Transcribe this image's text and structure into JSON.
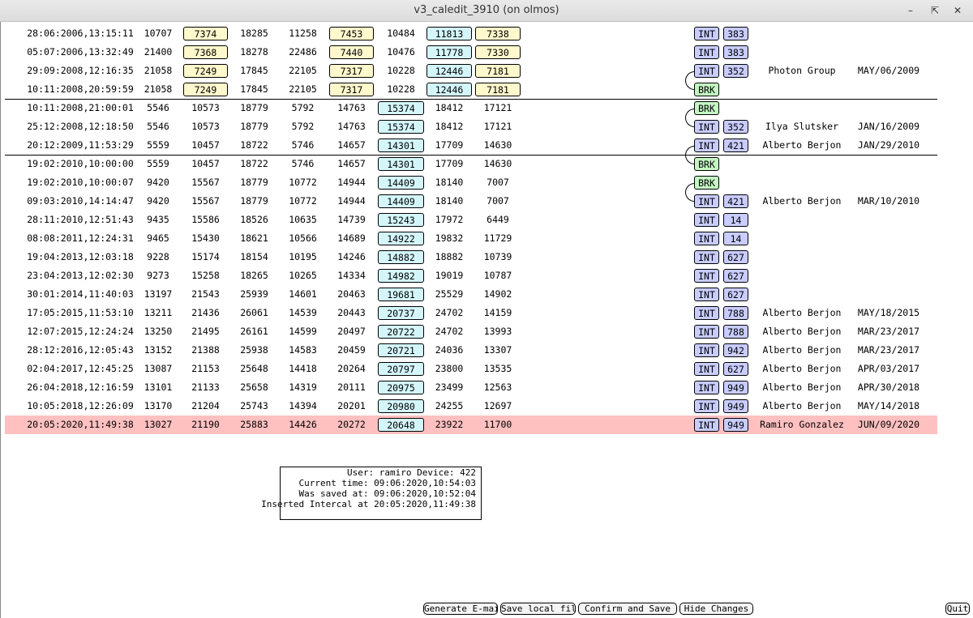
{
  "window": {
    "title": "v3_caledit_3910 (on olmos)"
  },
  "rows": [
    {
      "ts": "28:06:2006,13:15:11",
      "vals": [
        "10707",
        "7374",
        "18285",
        "11258",
        "7453",
        "10484",
        "11813",
        "7338"
      ],
      "type": "INT",
      "num": "383",
      "user": "",
      "date": ""
    },
    {
      "ts": "05:07:2006,13:32:49",
      "vals": [
        "21400",
        "7368",
        "18278",
        "22486",
        "7440",
        "10476",
        "11778",
        "7330"
      ],
      "type": "INT",
      "num": "383",
      "user": "",
      "date": ""
    },
    {
      "ts": "29:09:2008,12:16:35",
      "vals": [
        "21058",
        "7249",
        "17845",
        "22105",
        "7317",
        "10228",
        "12446",
        "7181"
      ],
      "type": "INT",
      "num": "352",
      "user": "Photon Group",
      "date": "MAY/06/2009"
    },
    {
      "ts": "10:11:2008,20:59:59",
      "vals": [
        "21058",
        "7249",
        "17845",
        "22105",
        "7317",
        "10228",
        "12446",
        "7181"
      ],
      "type": "BRK",
      "num": "",
      "user": "",
      "date": ""
    },
    {
      "ts": "10:11:2008,21:00:01",
      "vals": [
        "5546",
        "10573",
        "18779",
        "5792",
        "14763",
        "15374",
        "18412",
        "17121"
      ],
      "type": "BRK",
      "num": "",
      "user": "",
      "date": ""
    },
    {
      "ts": "25:12:2008,12:18:50",
      "vals": [
        "5546",
        "10573",
        "18779",
        "5792",
        "14763",
        "15374",
        "18412",
        "17121"
      ],
      "type": "INT",
      "num": "352",
      "user": "Ilya Slutsker",
      "date": "JAN/16/2009"
    },
    {
      "ts": "20:12:2009,11:53:29",
      "vals": [
        "5559",
        "10457",
        "18722",
        "5746",
        "14657",
        "14301",
        "17709",
        "14630"
      ],
      "type": "INT",
      "num": "421",
      "user": "Alberto Berjon",
      "date": "JAN/29/2010"
    },
    {
      "ts": "19:02:2010,10:00:00",
      "vals": [
        "5559",
        "10457",
        "18722",
        "5746",
        "14657",
        "14301",
        "17709",
        "14630"
      ],
      "type": "BRK",
      "num": "",
      "user": "",
      "date": ""
    },
    {
      "ts": "19:02:2010,10:00:07",
      "vals": [
        "9420",
        "15567",
        "18779",
        "10772",
        "14944",
        "14409",
        "18140",
        "7007"
      ],
      "type": "BRK",
      "num": "",
      "user": "",
      "date": ""
    },
    {
      "ts": "09:03:2010,14:14:47",
      "vals": [
        "9420",
        "15567",
        "18779",
        "10772",
        "14944",
        "14409",
        "18140",
        "7007"
      ],
      "type": "INT",
      "num": "421",
      "user": "Alberto Berjon",
      "date": "MAR/10/2010"
    },
    {
      "ts": "28:11:2010,12:51:43",
      "vals": [
        "9435",
        "15586",
        "18526",
        "10635",
        "14739",
        "15243",
        "17972",
        "6449"
      ],
      "type": "INT",
      "num": "14",
      "user": "",
      "date": ""
    },
    {
      "ts": "08:08:2011,12:24:31",
      "vals": [
        "9465",
        "15430",
        "18621",
        "10566",
        "14689",
        "14922",
        "19832",
        "11729"
      ],
      "type": "INT",
      "num": "14",
      "user": "",
      "date": ""
    },
    {
      "ts": "19:04:2013,12:03:18",
      "vals": [
        "9228",
        "15174",
        "18154",
        "10195",
        "14246",
        "14882",
        "18882",
        "10739"
      ],
      "type": "INT",
      "num": "627",
      "user": "",
      "date": ""
    },
    {
      "ts": "23:04:2013,12:02:30",
      "vals": [
        "9273",
        "15258",
        "18265",
        "10265",
        "14334",
        "14982",
        "19019",
        "10787"
      ],
      "type": "INT",
      "num": "627",
      "user": "",
      "date": ""
    },
    {
      "ts": "30:01:2014,11:40:03",
      "vals": [
        "13197",
        "21543",
        "25939",
        "14601",
        "20463",
        "19681",
        "25529",
        "14902"
      ],
      "type": "INT",
      "num": "627",
      "user": "",
      "date": ""
    },
    {
      "ts": "17:05:2015,11:53:10",
      "vals": [
        "13211",
        "21436",
        "26061",
        "14539",
        "20443",
        "20737",
        "24702",
        "14159"
      ],
      "type": "INT",
      "num": "788",
      "user": "Alberto Berjon",
      "date": "MAY/18/2015"
    },
    {
      "ts": "12:07:2015,12:24:24",
      "vals": [
        "13250",
        "21495",
        "26161",
        "14599",
        "20497",
        "20722",
        "24702",
        "13993"
      ],
      "type": "INT",
      "num": "788",
      "user": "Alberto Berjon",
      "date": "MAR/23/2017"
    },
    {
      "ts": "28:12:2016,12:05:43",
      "vals": [
        "13152",
        "21388",
        "25938",
        "14583",
        "20459",
        "20721",
        "24036",
        "13307"
      ],
      "type": "INT",
      "num": "942",
      "user": "Alberto Berjon",
      "date": "MAR/23/2017"
    },
    {
      "ts": "02:04:2017,12:45:25",
      "vals": [
        "13087",
        "21153",
        "25648",
        "14418",
        "20264",
        "20797",
        "23800",
        "13535"
      ],
      "type": "INT",
      "num": "627",
      "user": "Alberto Berjon",
      "date": "APR/03/2017"
    },
    {
      "ts": "26:04:2018,12:16:59",
      "vals": [
        "13101",
        "21133",
        "25658",
        "14319",
        "20111",
        "20975",
        "23499",
        "12563"
      ],
      "type": "INT",
      "num": "949",
      "user": "Alberto Berjon",
      "date": "APR/30/2018"
    },
    {
      "ts": "10:05:2018,12:26:09",
      "vals": [
        "13170",
        "21204",
        "25743",
        "14394",
        "20201",
        "20980",
        "24255",
        "12697"
      ],
      "type": "INT",
      "num": "949",
      "user": "Alberto Berjon",
      "date": "MAY/14/2018"
    },
    {
      "ts": "20:05:2020,11:49:38",
      "vals": [
        "13027",
        "21190",
        "25883",
        "14426",
        "20272",
        "20648",
        "23922",
        "11700"
      ],
      "type": "INT",
      "num": "949",
      "user": "Ramiro Gonzalez",
      "date": "JUN/09/2020"
    }
  ],
  "info": {
    "lines": [
      "User: ramiro Device: 422",
      "Current time: 09:06:2020,10:54:03",
      "Was saved at: 09:06:2020,10:52:04",
      "Inserted Intercal at 20:05:2020,11:49:38"
    ]
  },
  "buttons": {
    "generate_email": "Generate E-mail",
    "save_local": "Save local file",
    "confirm_save": "Confirm and Save",
    "hide_changes": "Hide Changes",
    "quit": "Quit"
  },
  "colors": {
    "yellow_box": "#fff8cc",
    "cyan_box": "#d4f6fb",
    "int_box": "#c8ccff",
    "brk_box": "#c4f6c4",
    "highlight_row": "#ffc0c0"
  }
}
